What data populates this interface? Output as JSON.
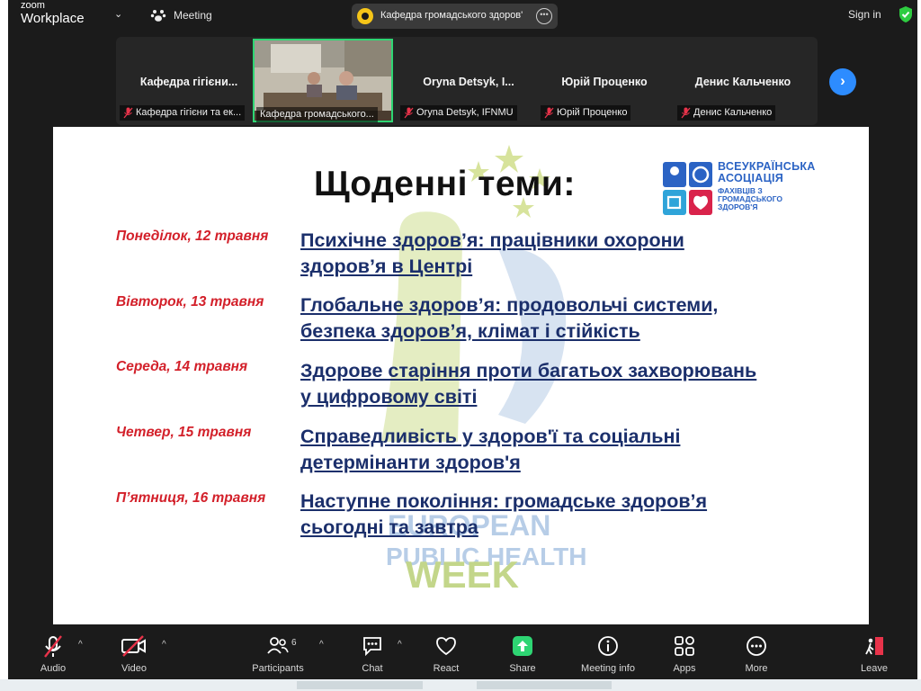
{
  "app": {
    "logo_top": "zoom",
    "logo_bottom": "Workplace",
    "meeting_label": "Meeting",
    "meeting_title": "Кафедра громадського здоров'",
    "sign_in": "Sign in"
  },
  "participants": [
    {
      "name": "Кафедра гігієни...",
      "label": "Кафедра гігієни та ек..."
    },
    {
      "name": "",
      "label": "Кафедра громадського..."
    },
    {
      "name": "Oryna Detsyk, I...",
      "label": "Oryna Detsyk, IFNMU"
    },
    {
      "name": "Юрій Проценко",
      "label": "Юрій Проценко"
    },
    {
      "name": "Денис Кальченко",
      "label": "Денис Кальченко"
    }
  ],
  "slide": {
    "title": "Щоденні теми:",
    "logo_line1": "ВСЕУКРАЇНСЬКА",
    "logo_line2": "АСОЦІАЦІЯ",
    "logo_line3": "ФАХІВЦІВ З ГРОМАДСЬКОГО",
    "logo_line4": "ЗДОРОВ'Я",
    "watermark_line1": "EUROPEAN",
    "watermark_line2": "PUBLIC HEALTH",
    "watermark_line3": "WEEK",
    "schedule": [
      {
        "day": "Понеділок, 12 травня",
        "topic_line1": "Психічне здоров’я: працівники охорони",
        "topic_line2": "здоров’я в Центрі"
      },
      {
        "day": "Вівторок, 13 травня",
        "topic_line1": "Глобальне здоров’я: продовольчі системи,",
        "topic_line2": "безпека здоров’я, клімат і стійкість"
      },
      {
        "day": "Середа, 14 травня",
        "topic_line1": "Здорове старіння проти багатьох захворювань",
        "topic_line2": "у цифровому світі"
      },
      {
        "day": "Четвер, 15 травня",
        "topic_line1": "Справедливість у здоров'ї та соціальні",
        "topic_line2": "детермінанти здоров'я"
      },
      {
        "day": "П’ятниця, 16 травня",
        "topic_line1": "Наступне покоління: громадське здоров’я",
        "topic_line2": "сьогодні та завтра"
      }
    ]
  },
  "toolbar": {
    "audio": "Audio",
    "video": "Video",
    "participants": "Participants",
    "participants_count": "6",
    "chat": "Chat",
    "react": "React",
    "share": "Share",
    "meeting_info": "Meeting info",
    "apps": "Apps",
    "more": "More",
    "leave": "Leave"
  },
  "colors": {
    "share_green": "#2ed573",
    "muted_red": "#e8334a",
    "day_red": "#d3202a",
    "topic_navy": "#1b2f6b",
    "next_blue": "#2d8cff"
  }
}
